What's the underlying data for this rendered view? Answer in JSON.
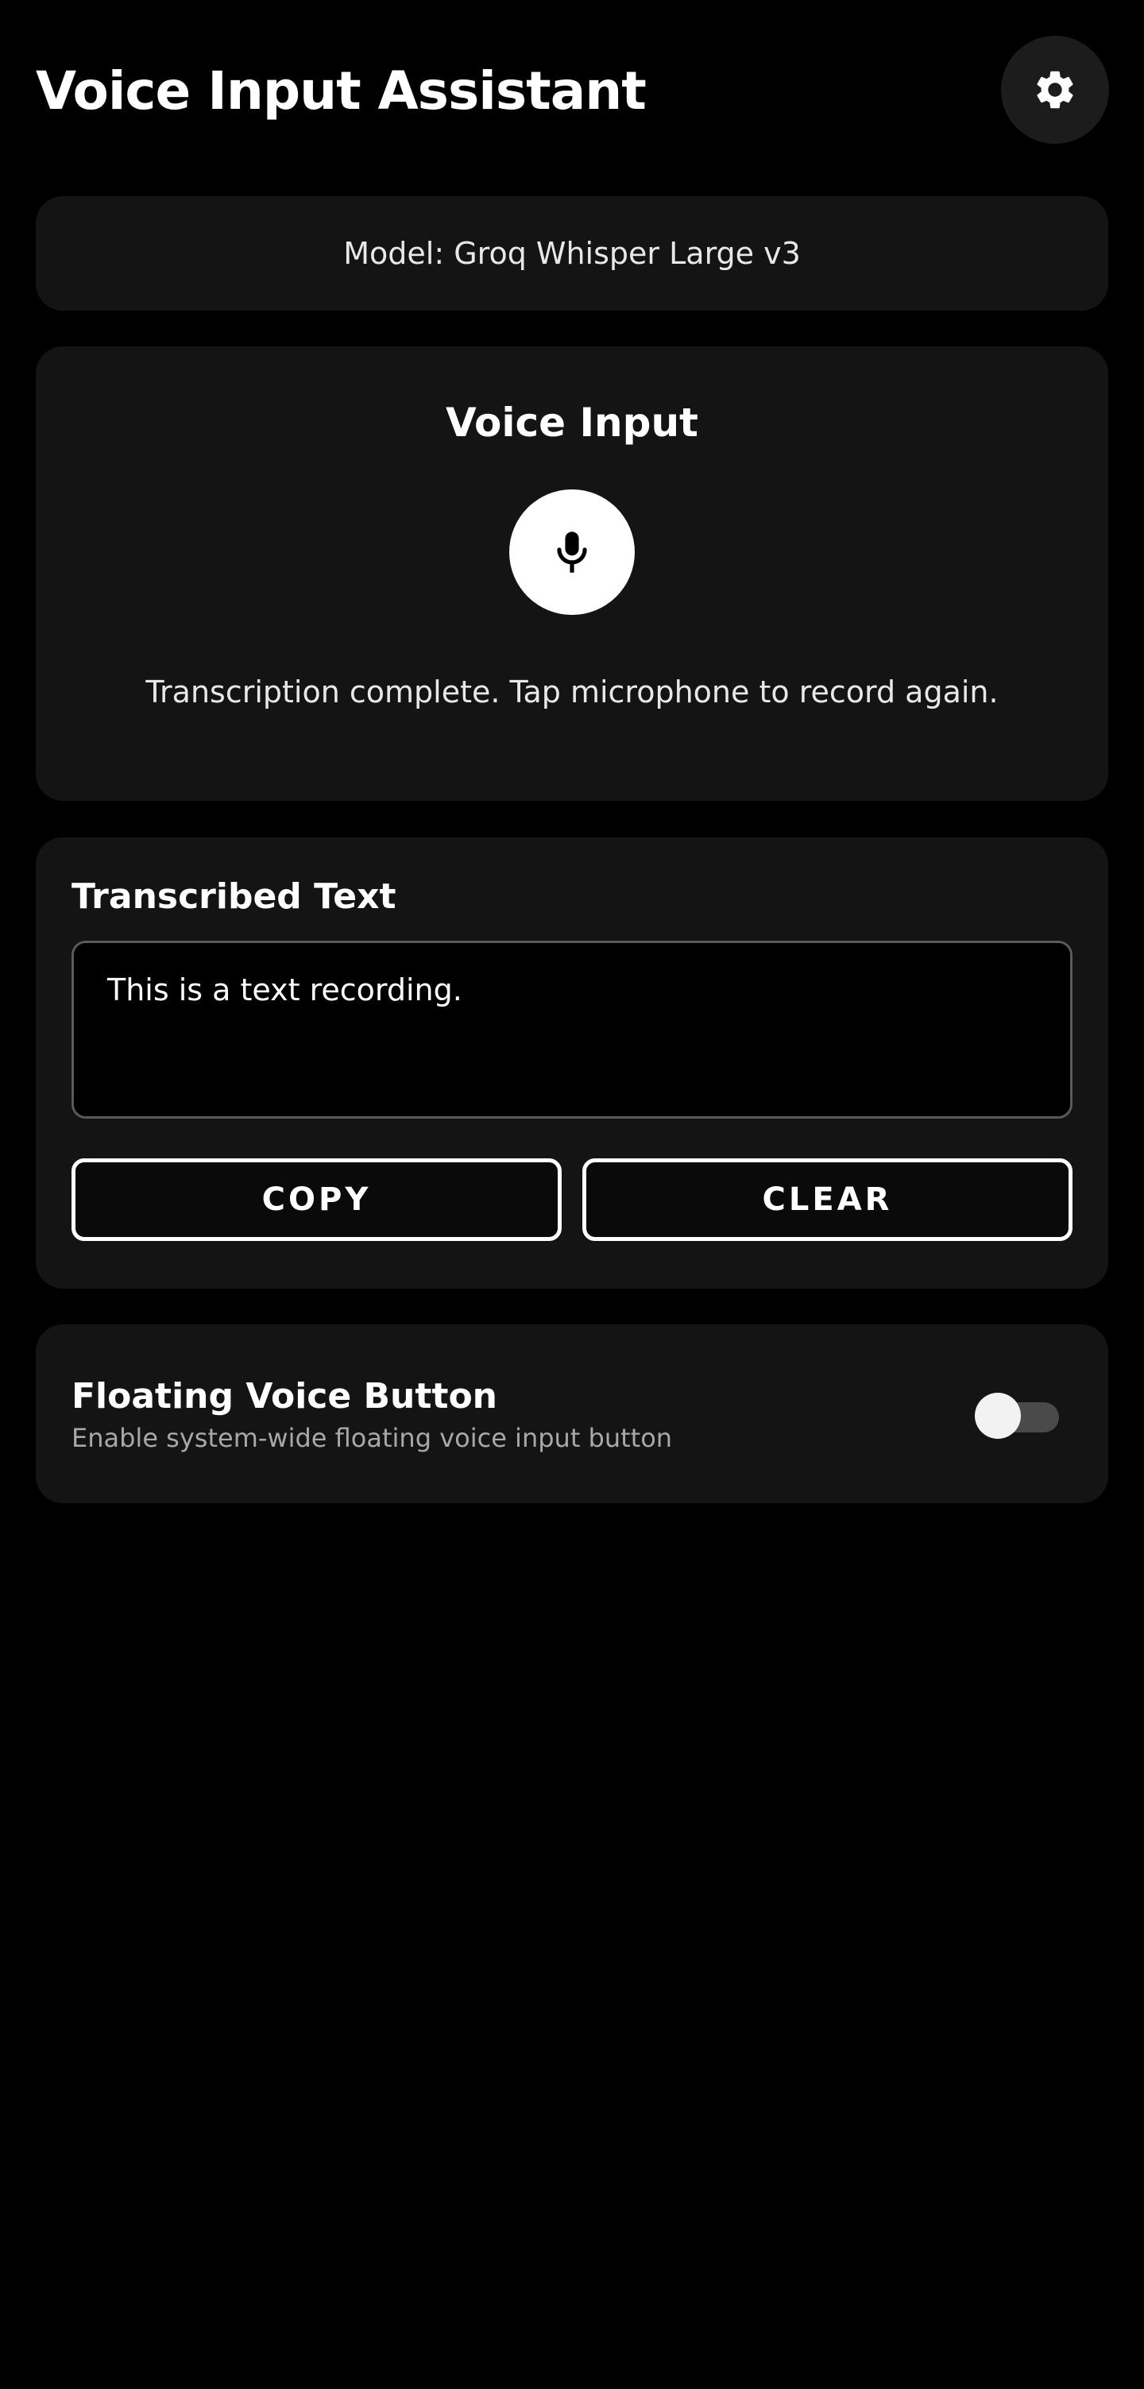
{
  "header": {
    "title": "Voice Input Assistant",
    "settings_icon": "gear-icon"
  },
  "model": {
    "label": "Model: Groq Whisper Large v3"
  },
  "voice": {
    "heading": "Voice Input",
    "mic_icon": "microphone-icon",
    "status": "Transcription complete. Tap microphone to record again."
  },
  "transcribed": {
    "heading": "Transcribed Text",
    "value": "This is a text recording.",
    "copy_label": "COPY",
    "clear_label": "CLEAR"
  },
  "floating": {
    "heading": "Floating Voice Button",
    "description": "Enable system-wide floating voice input button",
    "enabled": false
  },
  "colors": {
    "background": "#000000",
    "card": "#141414",
    "text_primary": "#ffffff",
    "text_secondary": "#a8a8a8"
  }
}
